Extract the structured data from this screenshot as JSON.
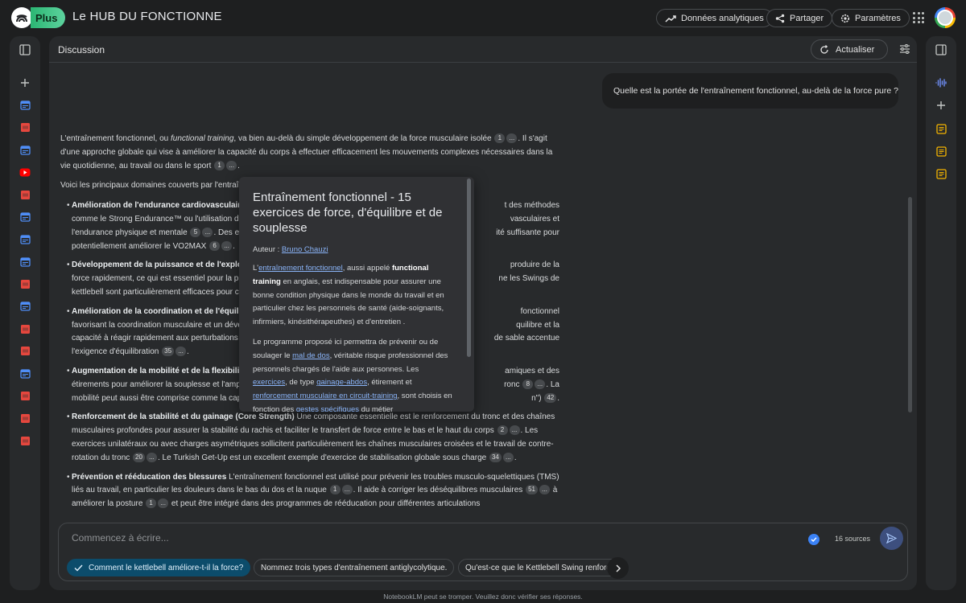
{
  "app": {
    "plan_badge": "Plus",
    "notebook_title": "Le HUB DU FONCTIONNE"
  },
  "header": {
    "analytics_label": "Données analytiques",
    "share_label": "Partager",
    "settings_label": "Paramètres"
  },
  "left_panel": {
    "icons": [
      "panel-toggle-icon",
      "add-icon",
      "web-source-icon",
      "pdf-source-icon",
      "web-source-icon",
      "youtube-source-icon",
      "pdf-source-icon",
      "web-source-icon",
      "web-source-icon",
      "web-source-icon",
      "pdf-source-icon",
      "web-source-icon",
      "pdf-source-icon",
      "pdf-source-icon",
      "web-source-icon",
      "pdf-source-icon",
      "pdf-source-icon",
      "pdf-source-icon"
    ]
  },
  "chat": {
    "title": "Discussion",
    "refresh_label": "Actualiser",
    "user_message": "Quelle est la portée de l'entraînement fonctionnel, au-delà de la force pure ?",
    "intro": {
      "t1": "L'entraînement fonctionnel, ou ",
      "t1_em": "functional training",
      "t2": ", va bien au-delà du simple développement de la force musculaire isolée ",
      "c1": "1",
      "more": "...",
      "t3": ". Il s'agit d'une approche globale qui vise à améliorer la capacité du corps à effectuer efficacement les mouvements complexes nécessaires dans la vie quotidienne, au travail ou dans le sport ",
      "c2": "1",
      "t4": "."
    },
    "domains_intro": "Voici les principaux domaines couverts par l'entraî",
    "bullets": [
      {
        "title": "Amélioration de l'endurance cardiovasculaire",
        "a": "comme le Strong Endurance™ ou l'utilisation de",
        "b": "l'endurance physique et mentale ",
        "c1": "5",
        "c": ". Des ex",
        "d": "potentiellement améliorer le VO2MAX ",
        "c2": "6",
        "e": ".",
        "r1": "t des méthodes",
        "r2": "vasculaires et",
        "r3": "ité suffisante pour"
      },
      {
        "title": "Développement de la puissance et de l'explos",
        "a": "force rapidement, ce qui est essentiel pour la pu",
        "b": "kettlebell sont particulièrement efficaces pour c",
        "r1": "produire de la",
        "r2": "ne les Swings de"
      },
      {
        "title": "Amélioration de la coordination et de l'équilib",
        "a": "favorisant la coordination musculaire et un déve",
        "b": "capacité à réagir rapidement aux perturbations",
        "c": "l'exigence d'équilibration ",
        "c1": "35",
        "e": ".",
        "r1": "fonctionnel",
        "r2": "quilibre et la",
        "r3": "de sable accentue"
      },
      {
        "title": "Augmentation de la mobilité et de la flexibilit",
        "a": "étirements pour améliorer la souplesse et l'amp",
        "b": "mobilité peut aussi être comprise comme la cap",
        "r1": "amiques et des",
        "r2": "ronc ",
        "rc1": "8",
        "r3": ". La",
        "r4": "n\") ",
        "rc2": "42",
        "r5": "."
      },
      {
        "title": "Renforcement de la stabilité et du gainage (Core Strength)",
        "text1": " Une composante essentielle est le renforcement du tronc et des chaînes musculaires profondes pour assurer la stabilité du rachis et faciliter le transfert de force entre le bas et le haut du corps ",
        "c1": "2",
        "text2": ". Les exercices unilatéraux ou avec charges asymétriques sollicitent particulièrement les chaînes musculaires croisées et le travail de contre-rotation du tronc ",
        "c2": "20",
        "text3": ". Le Turkish Get-Up est un excellent exemple d'exercice de stabilisation globale sous charge ",
        "c3": "34",
        "text4": "."
      },
      {
        "title": "Prévention et rééducation des blessures",
        "text1": " L'entraînement fonctionnel est utilisé pour prévenir les troubles musculo-squelettiques (TMS) liés au travail, en particulier les douleurs dans le bas du dos et la nuque ",
        "c1": "1",
        "text2": ". Il aide à corriger les déséquilibres musculaires ",
        "c2": "51",
        "text3": " à améliorer la posture ",
        "c3": "1",
        "text4": " et peut être intégré dans des programmes de rééducation pour différentes articulations"
      }
    ]
  },
  "popup": {
    "title": "Entraînement fonctionnel - 15 exercices de force, d'équilibre et de souplesse",
    "author_label": "Auteur : ",
    "author": "Bruno Chauzi",
    "p1": {
      "t1": "L'",
      "l1": "entraînement fonctionnel",
      "t2": ", aussi appelé ",
      "b1": "functional training",
      "t3": " en anglais, est indispensable pour assurer une bonne condition physique dans le monde du travail et en particulier chez les personnels de santé (aide-soignants, infirmiers, kinésithérapeuthes) et d'entretien ."
    },
    "p2": {
      "t1": "Le programme proposé ici permettra de prévenir ou de soulager le ",
      "l1": "mal de dos",
      "t2": ", véritable risque professionnel des personnels chargés de l'aide aux personnes. Les ",
      "l2": "exercices",
      "t3": ", de type ",
      "l3": "gainage-abdos",
      "t4": ", étirement et ",
      "l4": "renforcement musculaire en circuit-training",
      "t5": ", sont choisis en fonction des ",
      "l5": "gestes spécifiques",
      "t6": " du métier"
    }
  },
  "composer": {
    "placeholder": "Commencez à écrire...",
    "sources_count": "16 sources",
    "suggestions": [
      "Comment le kettlebell améliore-t-il la force?",
      "Nommez trois types d'entraînement antiglycolytique.",
      "Qu'est-ce que le Kettlebell Swing renforce"
    ]
  },
  "right_panel": {
    "icons": [
      "panel-toggle-icon",
      "audio-overview-icon",
      "add-note-icon",
      "note-icon",
      "note-icon",
      "note-icon"
    ]
  },
  "footer": {
    "disclaimer": "NotebookLM peut se tromper. Veuillez donc vérifier ses réponses."
  },
  "colors": {
    "accent_blue": "#3b82f6",
    "pdf_red": "#e5473e",
    "web_blue": "#4f8ef7",
    "note_yellow": "#f4b400",
    "chip_active": "#0c4c6b"
  }
}
